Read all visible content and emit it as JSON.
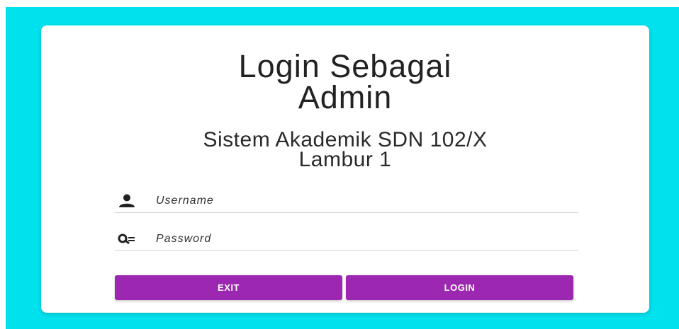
{
  "login": {
    "title_line1": "Login Sebagai",
    "title_line2": "Admin",
    "subtitle_line1": "Sistem Akademik SDN 102/X",
    "subtitle_line2": "Lambur 1"
  },
  "form": {
    "username_placeholder": "Username",
    "password_placeholder": "Password"
  },
  "buttons": {
    "exit_label": "EXIT",
    "login_label": "LOGIN"
  },
  "icons": {
    "username": "user-icon",
    "password": "key-icon"
  },
  "colors": {
    "background": "#00e1ee",
    "button": "#9c27b0"
  }
}
